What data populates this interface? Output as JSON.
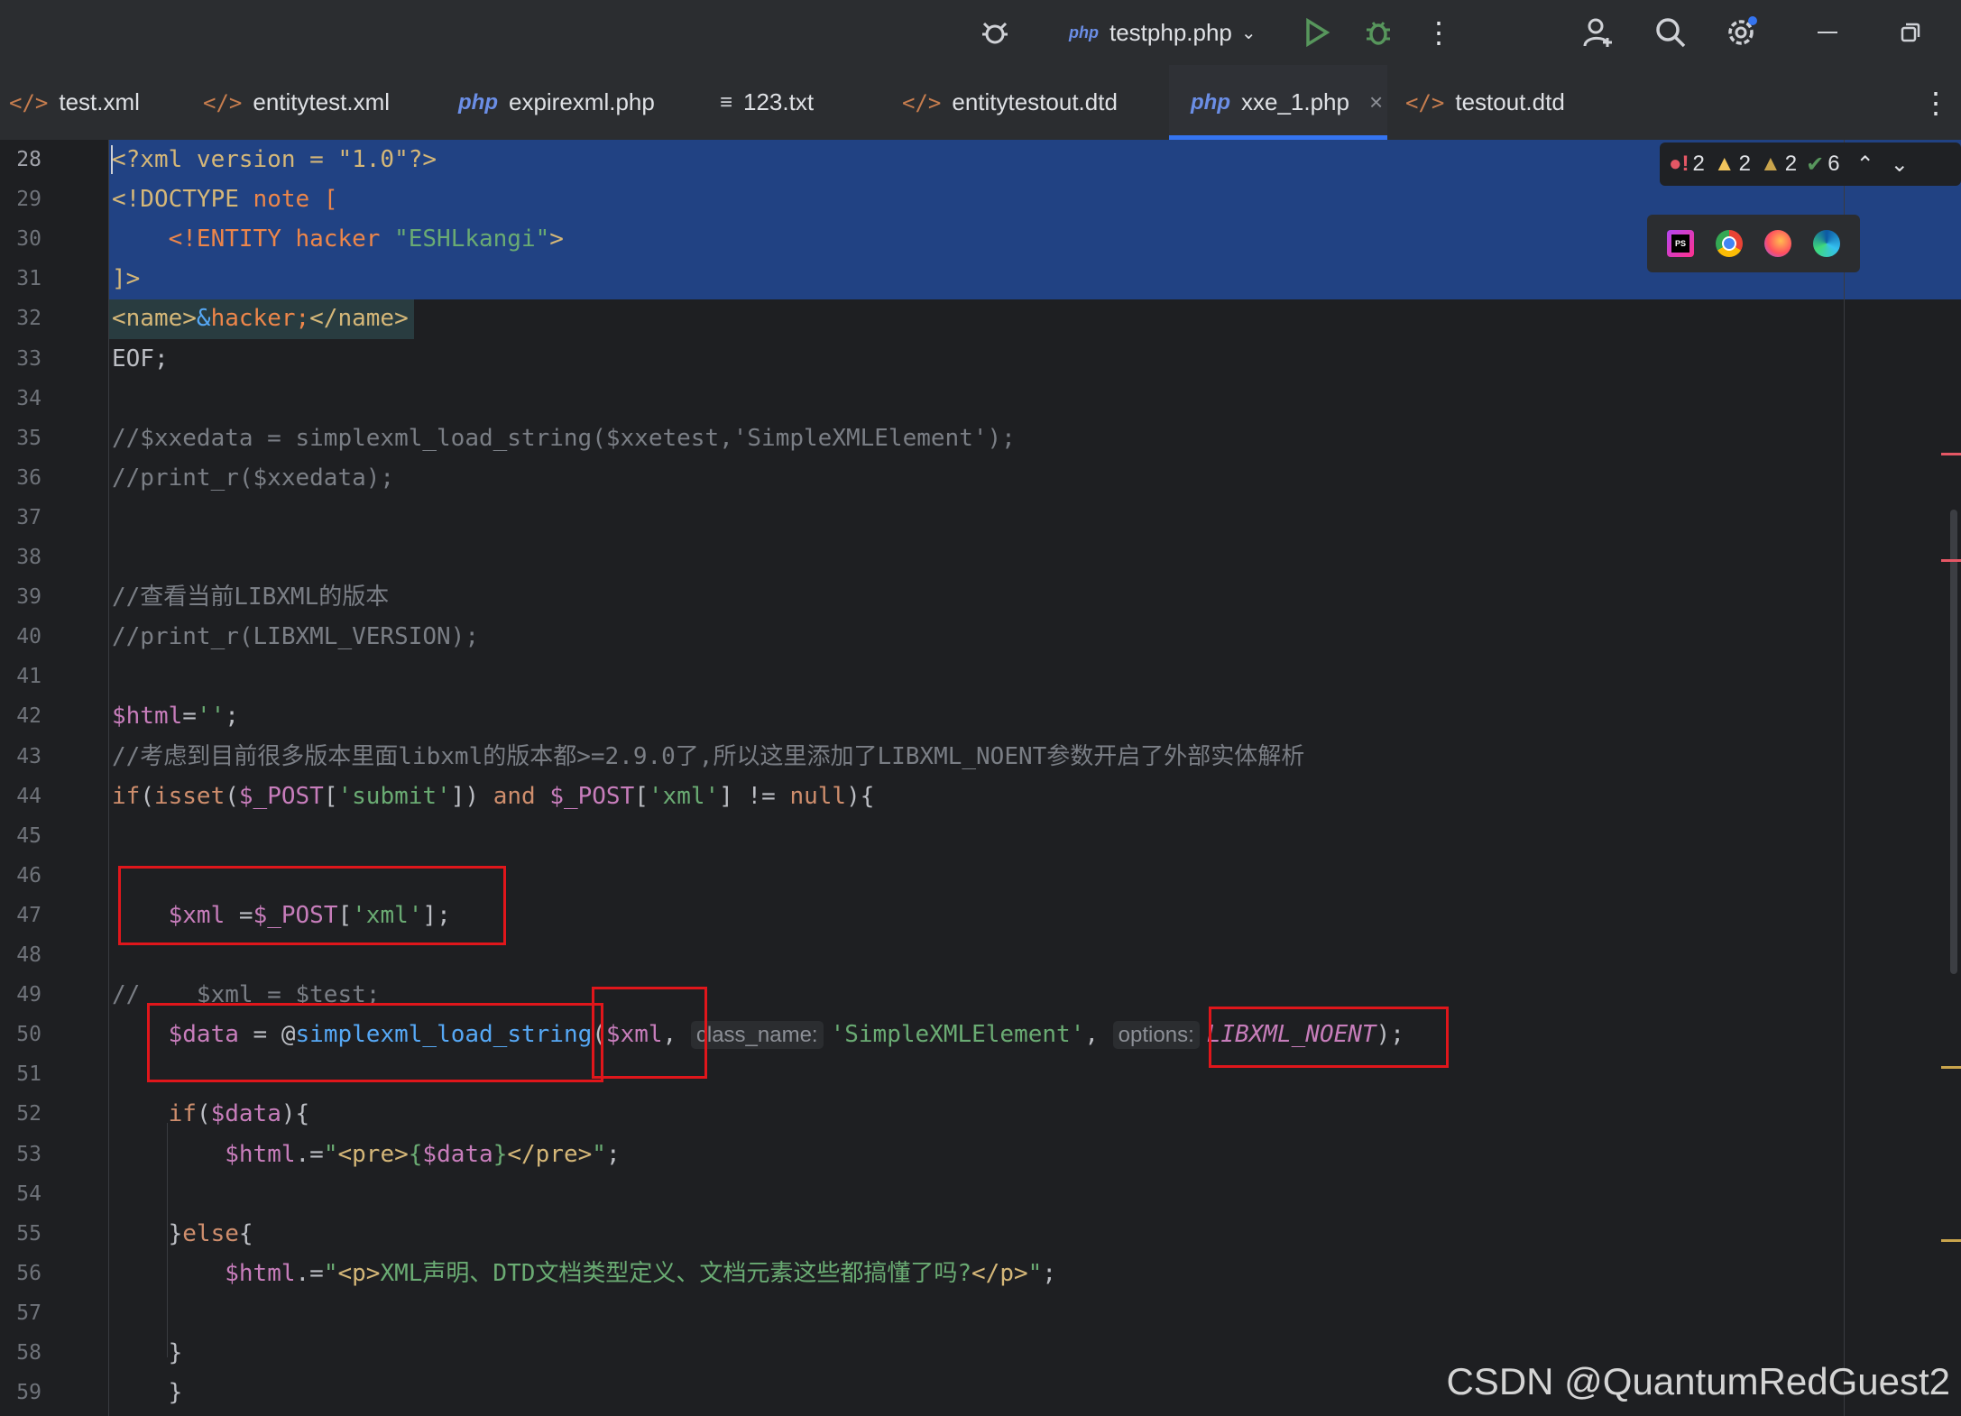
{
  "titlebar": {
    "run_config": "testphp.php"
  },
  "tabs": [
    {
      "label": "test.xml",
      "icon": "xml-file-icon"
    },
    {
      "label": "entitytest.xml",
      "icon": "xml-file-icon"
    },
    {
      "label": "expirexml.php",
      "icon": "php-file-icon"
    },
    {
      "label": "123.txt",
      "icon": "text-file-icon"
    },
    {
      "label": "entitytestout.dtd",
      "icon": "xml-file-icon"
    },
    {
      "label": "xxe_1.php",
      "icon": "php-file-icon",
      "active": true
    },
    {
      "label": "testout.dtd",
      "icon": "xml-file-icon"
    }
  ],
  "inspections": {
    "errors": "2",
    "warnings": "2",
    "weak_warnings": "2",
    "ok": "6"
  },
  "hints": {
    "class_name": "class_name:",
    "options": "options:"
  },
  "lines": [
    {
      "n": "28",
      "code": [
        [
          "t",
          "<?xml version = \"1.0\"?>"
        ]
      ]
    },
    {
      "n": "29",
      "code": [
        [
          "t",
          "<!DOCTYPE "
        ],
        [
          "e",
          "note ["
        ]
      ]
    },
    {
      "n": "30",
      "code": [
        [
          "p",
          "    "
        ],
        [
          "e",
          "<!ENTITY hacker "
        ],
        [
          "s",
          "\"ESHLkangi\""
        ],
        [
          "t",
          ">"
        ]
      ]
    },
    {
      "n": "31",
      "code": [
        [
          "t",
          "]>"
        ]
      ]
    },
    {
      "n": "32",
      "code": [
        [
          "t",
          "<name>"
        ],
        [
          "f",
          "&"
        ],
        [
          "e",
          "hacker;"
        ],
        [
          "t",
          "</name>"
        ]
      ]
    },
    {
      "n": "33",
      "code": [
        [
          "p",
          "EOF;"
        ]
      ]
    },
    {
      "n": "34",
      "code": []
    },
    {
      "n": "35",
      "code": [
        [
          "c",
          "//$xxedata = simplexml_load_string($xxetest,'SimpleXMLElement');"
        ]
      ]
    },
    {
      "n": "36",
      "code": [
        [
          "c",
          "//print_r($xxedata);"
        ]
      ]
    },
    {
      "n": "37",
      "code": []
    },
    {
      "n": "38",
      "code": []
    },
    {
      "n": "39",
      "code": [
        [
          "c",
          "//查看当前LIBXML的版本"
        ]
      ]
    },
    {
      "n": "40",
      "code": [
        [
          "c",
          "//print_r(LIBXML_VERSION);"
        ]
      ]
    },
    {
      "n": "41",
      "code": []
    },
    {
      "n": "42",
      "code": [
        [
          "v",
          "$html"
        ],
        [
          "p",
          "="
        ],
        [
          "s",
          "''"
        ],
        [
          "p",
          ";"
        ]
      ]
    },
    {
      "n": "43",
      "code": [
        [
          "c",
          "//考虑到目前很多版本里面libxml的版本都>=2.9.0了,所以这里添加了LIBXML_NOENT参数开启了外部实体解析"
        ]
      ]
    },
    {
      "n": "44",
      "code": [
        [
          "k",
          "if"
        ],
        [
          "p",
          "("
        ],
        [
          "k",
          "isset"
        ],
        [
          "p",
          "("
        ],
        [
          "v",
          "$_POST"
        ],
        [
          "p",
          "["
        ],
        [
          "s",
          "'submit'"
        ],
        [
          "p",
          "]) "
        ],
        [
          "k",
          "and "
        ],
        [
          "v",
          "$_POST"
        ],
        [
          "p",
          "["
        ],
        [
          "s",
          "'xml'"
        ],
        [
          "p",
          "] != "
        ],
        [
          "k",
          "null"
        ],
        [
          "p",
          "){"
        ]
      ]
    },
    {
      "n": "45",
      "code": []
    },
    {
      "n": "46",
      "code": []
    },
    {
      "n": "47",
      "code": [
        [
          "p",
          "    "
        ],
        [
          "v",
          "$xml "
        ],
        [
          "p",
          "="
        ],
        [
          "v",
          "$_POST"
        ],
        [
          "p",
          "["
        ],
        [
          "s",
          "'xml'"
        ],
        [
          "p",
          "];"
        ]
      ]
    },
    {
      "n": "48",
      "code": []
    },
    {
      "n": "49",
      "code": [
        [
          "c",
          "//    $xml = $test;"
        ]
      ]
    },
    {
      "n": "50",
      "code": [
        [
          "p",
          "    "
        ],
        [
          "v",
          "$data"
        ],
        [
          "p",
          " = @"
        ],
        [
          "f",
          "simplexml_load_string"
        ],
        [
          "p",
          "("
        ],
        [
          "v",
          "$xml"
        ],
        [
          "p",
          ", "
        ],
        [
          "h",
          "class_name"
        ],
        [
          "s",
          "'SimpleXMLElement'"
        ],
        [
          "p",
          ", "
        ],
        [
          "h",
          "options"
        ],
        [
          "cl",
          "LIBXML_NOENT"
        ],
        [
          "p",
          ");"
        ]
      ]
    },
    {
      "n": "51",
      "code": []
    },
    {
      "n": "52",
      "code": [
        [
          "p",
          "    "
        ],
        [
          "k",
          "if"
        ],
        [
          "p",
          "("
        ],
        [
          "v",
          "$data"
        ],
        [
          "p",
          "){"
        ]
      ]
    },
    {
      "n": "53",
      "code": [
        [
          "p",
          "        "
        ],
        [
          "v",
          "$html"
        ],
        [
          "p",
          ".="
        ],
        [
          "s",
          "\""
        ],
        [
          "t",
          "<pre>"
        ],
        [
          "s",
          "{"
        ],
        [
          "v",
          "$data"
        ],
        [
          "s",
          "}"
        ],
        [
          "t",
          "</pre>"
        ],
        [
          "s",
          "\""
        ],
        [
          "p",
          ";"
        ]
      ]
    },
    {
      "n": "54",
      "code": []
    },
    {
      "n": "55",
      "code": [
        [
          "p",
          "    }"
        ],
        [
          "k",
          "else"
        ],
        [
          "p",
          "{"
        ]
      ]
    },
    {
      "n": "56",
      "code": [
        [
          "p",
          "        "
        ],
        [
          "v",
          "$html"
        ],
        [
          "p",
          ".="
        ],
        [
          "s",
          "\""
        ],
        [
          "t",
          "<p>"
        ],
        [
          "s",
          "XML声明、DTD文档类型定义、文档元素这些都搞懂了吗?"
        ],
        [
          "t",
          "</p>"
        ],
        [
          "s",
          "\""
        ],
        [
          "p",
          ";"
        ]
      ]
    },
    {
      "n": "57",
      "code": []
    },
    {
      "n": "58",
      "code": [
        [
          "p",
          "    }"
        ]
      ]
    },
    {
      "n": "59",
      "code": [
        [
          "p",
          "    }"
        ]
      ]
    }
  ],
  "watermark": "CSDN @QuantumRedGuest2"
}
